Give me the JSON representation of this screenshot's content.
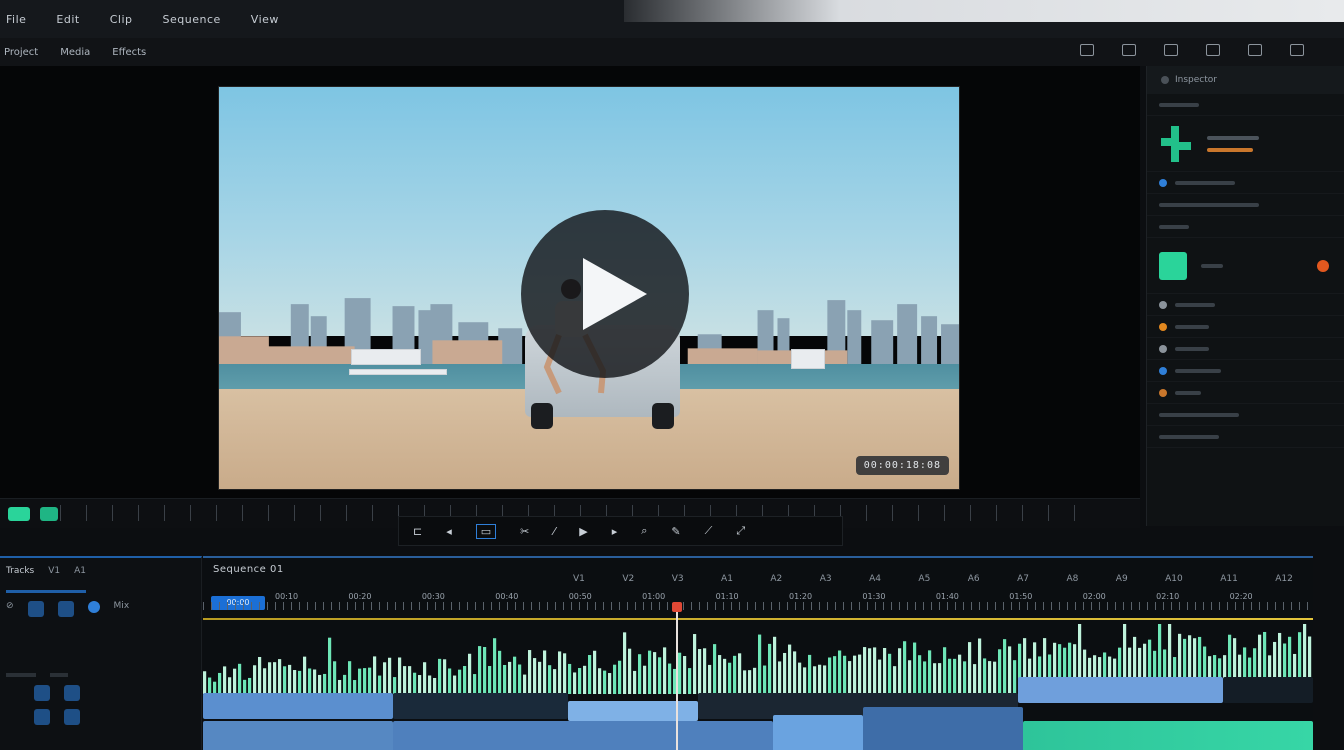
{
  "menubar": {
    "items": [
      "File",
      "Edit",
      "Clip",
      "Sequence",
      "View"
    ]
  },
  "toolbar": {
    "items": [
      "Project",
      "Media",
      "Effects"
    ],
    "right_icons": [
      "hand-icon",
      "search-icon",
      "lock-icon",
      "camera-icon",
      "settings-icon",
      "export-icon"
    ]
  },
  "viewer": {
    "chip": "00:00:18:08"
  },
  "transport": {
    "controls": [
      "mark-in",
      "step-back",
      "loop",
      "cut",
      "step",
      "play",
      "search",
      "edit",
      "trim",
      "expand"
    ]
  },
  "timeline": {
    "title": "Sequence 01",
    "badge": "00:00",
    "ruler_labels": [
      "00:10",
      "00:20",
      "00:30",
      "00:40",
      "00:50",
      "01:00",
      "01:10",
      "01:20",
      "01:30",
      "01:40",
      "01:50",
      "02:00",
      "02:10",
      "02:20"
    ],
    "section_labels": [
      "V1",
      "V2",
      "V3",
      "A1",
      "A2",
      "A3",
      "A4",
      "A5",
      "A6",
      "A7",
      "A8",
      "A9",
      "A10",
      "A11",
      "A12"
    ]
  },
  "left_panel": {
    "labels": [
      "Tracks",
      "V1",
      "A1",
      "Mix"
    ]
  },
  "right_panel": {
    "title": "Inspector",
    "accent": "#22c08a"
  },
  "colors": {
    "accent_green": "#2ad49a",
    "accent_blue": "#2f7fd8",
    "playhead": "#e04835",
    "audio_wave": "#6ee6b7"
  }
}
